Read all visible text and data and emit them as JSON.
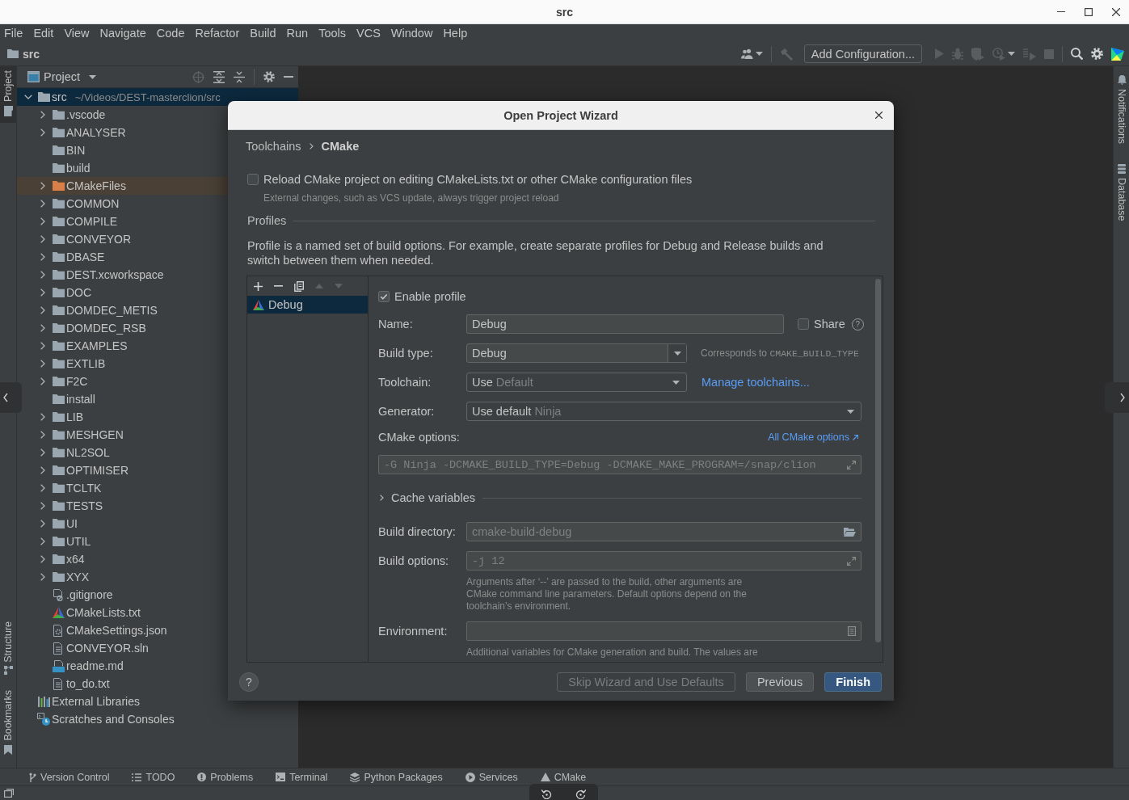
{
  "window": {
    "title": "src"
  },
  "menu": [
    {
      "label": "File"
    },
    {
      "label": "Edit"
    },
    {
      "label": "View"
    },
    {
      "label": "Navigate"
    },
    {
      "label": "Code"
    },
    {
      "label": "Refactor"
    },
    {
      "label": "Build"
    },
    {
      "label": "Run"
    },
    {
      "label": "Tools"
    },
    {
      "label": "VCS"
    },
    {
      "label": "Window"
    },
    {
      "label": "Help"
    }
  ],
  "navigation_bar": {
    "breadcrumb": "src",
    "run_configuration": "Add Configuration..."
  },
  "left_stripe": {
    "top": [
      {
        "label": "Project",
        "selected": true
      }
    ],
    "bottom": [
      {
        "label": "Structure",
        "selected": false
      },
      {
        "label": "Bookmarks",
        "selected": false
      }
    ]
  },
  "right_stripe": [
    {
      "label": "Notifications",
      "selected": false
    },
    {
      "label": "Database",
      "selected": false
    }
  ],
  "project_panel": {
    "title": "Project",
    "tree": [
      {
        "label": "src",
        "path": "~/Videos/DEST-masterclion/src",
        "kind": "folder",
        "expanded": true,
        "selected": true,
        "children": [
          {
            "label": ".vscode",
            "kind": "folder",
            "expanded": false,
            "selected": false
          },
          {
            "label": "ANALYSER",
            "kind": "folder",
            "expanded": false,
            "selected": false
          },
          {
            "label": "BIN",
            "kind": "empty-folder",
            "selected": false
          },
          {
            "label": "build",
            "kind": "empty-folder",
            "selected": false
          },
          {
            "label": "CMakeFiles",
            "kind": "excluded-folder",
            "expanded": false,
            "selected": false
          },
          {
            "label": "COMMON",
            "kind": "folder",
            "expanded": false,
            "selected": false
          },
          {
            "label": "COMPILE",
            "kind": "folder",
            "expanded": false,
            "selected": false
          },
          {
            "label": "CONVEYOR",
            "kind": "folder",
            "expanded": false,
            "selected": false
          },
          {
            "label": "DBASE",
            "kind": "folder",
            "expanded": false,
            "selected": false
          },
          {
            "label": "DEST.xcworkspace",
            "kind": "folder",
            "expanded": false,
            "selected": false
          },
          {
            "label": "DOC",
            "kind": "folder",
            "expanded": false,
            "selected": false
          },
          {
            "label": "DOMDEC_METIS",
            "kind": "folder",
            "expanded": false,
            "selected": false
          },
          {
            "label": "DOMDEC_RSB",
            "kind": "folder",
            "expanded": false,
            "selected": false
          },
          {
            "label": "EXAMPLES",
            "kind": "folder",
            "expanded": false,
            "selected": false
          },
          {
            "label": "EXTLIB",
            "kind": "folder",
            "expanded": false,
            "selected": false
          },
          {
            "label": "F2C",
            "kind": "folder",
            "expanded": false,
            "selected": false
          },
          {
            "label": "install",
            "kind": "empty-folder",
            "selected": false
          },
          {
            "label": "LIB",
            "kind": "folder",
            "expanded": false,
            "selected": false
          },
          {
            "label": "MESHGEN",
            "kind": "folder",
            "expanded": false,
            "selected": false
          },
          {
            "label": "NL2SOL",
            "kind": "folder",
            "expanded": false,
            "selected": false
          },
          {
            "label": "OPTIMISER",
            "kind": "folder",
            "expanded": false,
            "selected": false
          },
          {
            "label": "TCLTK",
            "kind": "folder",
            "expanded": false,
            "selected": false
          },
          {
            "label": "TESTS",
            "kind": "folder",
            "expanded": false,
            "selected": false
          },
          {
            "label": "UI",
            "kind": "folder",
            "expanded": false,
            "selected": false
          },
          {
            "label": "UTIL",
            "kind": "folder",
            "expanded": false,
            "selected": false
          },
          {
            "label": "x64",
            "kind": "folder",
            "expanded": false,
            "selected": false
          },
          {
            "label": "XYX",
            "kind": "folder",
            "expanded": false,
            "selected": false
          },
          {
            "label": ".gitignore",
            "kind": "ignore-file",
            "selected": false
          },
          {
            "label": "CMakeLists.txt",
            "kind": "cmake-file",
            "selected": false
          },
          {
            "label": "CMakeSettings.json",
            "kind": "settings-file",
            "selected": false
          },
          {
            "label": "CONVEYOR.sln",
            "kind": "document-file",
            "selected": false
          },
          {
            "label": "readme.md",
            "kind": "markdown-file",
            "selected": false
          },
          {
            "label": "to_do.txt",
            "kind": "text-file",
            "selected": false
          }
        ]
      },
      {
        "label": "External Libraries",
        "kind": "libraries",
        "selected": false
      },
      {
        "label": "Scratches and Consoles",
        "kind": "scratches",
        "selected": false
      }
    ]
  },
  "dialog": {
    "title": "Open Project Wizard",
    "breadcrumb": [
      {
        "label": "Toolchains",
        "current": false
      },
      {
        "label": "CMake",
        "current": true
      }
    ],
    "reload_option": {
      "label": "Reload CMake project on editing CMakeLists.txt or other CMake configuration files",
      "checked": false,
      "hint": "External changes, such as VCS update, always trigger project reload"
    },
    "profiles_title": "Profiles",
    "profiles_description": "Profile is a named set of build options. For example, create separate profiles for Debug and Release builds and switch between them when needed.",
    "profiles": [
      {
        "name": "Debug",
        "selected": true
      }
    ],
    "form": {
      "enable_profile": {
        "label": "Enable profile",
        "checked": true
      },
      "name": {
        "label": "Name:",
        "value": "Debug"
      },
      "share": {
        "label": "Share",
        "checked": false,
        "help": "?"
      },
      "build_type": {
        "label": "Build type:",
        "value": "Debug",
        "note": "Corresponds to",
        "note_code": "CMAKE_BUILD_TYPE"
      },
      "toolchain": {
        "label": "Toolchain:",
        "value": "Use",
        "hint": "Default",
        "link": "Manage toolchains..."
      },
      "generator": {
        "label": "Generator:",
        "value": "Use default",
        "hint": "Ninja"
      },
      "cmake_options": {
        "label": "CMake options:",
        "link": "All CMake options",
        "placeholder": "-G Ninja -DCMAKE_BUILD_TYPE=Debug -DCMAKE_MAKE_PROGRAM=/snap/clion"
      },
      "cache_variables": {
        "label": "Cache variables",
        "expanded": false
      },
      "build_directory": {
        "label": "Build directory:",
        "placeholder": "cmake-build-debug"
      },
      "build_options": {
        "label": "Build options:",
        "placeholder": "-j 12",
        "hint": "Arguments after ‘--’ are passed to the build, other arguments are CMake command line parameters. Default options depend on the toolchain’s environment."
      },
      "environment": {
        "label": "Environment:",
        "hint": "Additional variables for CMake generation and build. The values are"
      }
    },
    "help_button": "?",
    "buttons": [
      {
        "label": "Skip Wizard and Use Defaults",
        "kind": "secondary",
        "disabled": true
      },
      {
        "label": "Previous",
        "kind": "secondary",
        "disabled": false
      },
      {
        "label": "Finish",
        "kind": "default",
        "disabled": false
      }
    ]
  },
  "bottom_tool_bar": [
    {
      "label": "Version Control",
      "selected": false
    },
    {
      "label": "TODO",
      "selected": false
    },
    {
      "label": "Problems",
      "selected": false
    },
    {
      "label": "Terminal",
      "selected": false
    },
    {
      "label": "Python Packages",
      "selected": false
    },
    {
      "label": "Services",
      "selected": false
    },
    {
      "label": "CMake",
      "selected": false
    }
  ]
}
